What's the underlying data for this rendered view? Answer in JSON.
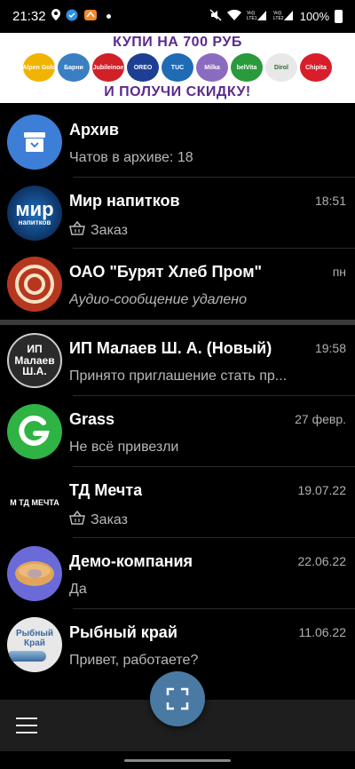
{
  "status_bar": {
    "time": "21:32",
    "battery": "100%",
    "signal1": "Vo))\nLTE1",
    "signal2": "Vo))\nLTE2"
  },
  "ad": {
    "line1": "КУПИ НА 700 РУБ",
    "line2": "И ПОЛУЧИ СКИДКУ!",
    "logos": [
      {
        "label": "Alpen Gold",
        "color": "#f0b400"
      },
      {
        "label": "Барни",
        "color": "#3a7fc1"
      },
      {
        "label": "Jubileinoe",
        "color": "#d02028"
      },
      {
        "label": "OREO",
        "color": "#1c3f94"
      },
      {
        "label": "TUC",
        "color": "#1f6bb4"
      },
      {
        "label": "Milka",
        "color": "#8b6bbf"
      },
      {
        "label": "belVita",
        "color": "#2a9a3c"
      },
      {
        "label": "Dirol",
        "color": "#e8e8e8"
      },
      {
        "label": "Chipita",
        "color": "#d81e2a"
      }
    ]
  },
  "chats": [
    {
      "name": "Архив",
      "time": "",
      "preview": "Чатов в архиве: 18",
      "preview_style": "normal",
      "basket": false,
      "avatar": "archive"
    },
    {
      "name": "Мир напитков",
      "time": "18:51",
      "preview": "Заказ",
      "preview_style": "normal",
      "basket": true,
      "avatar": "mir"
    },
    {
      "name": "ОАО \"Бурят Хлеб Пром\"",
      "time": "пн",
      "preview": "Аудио-сообщение удалено",
      "preview_style": "italic",
      "basket": false,
      "avatar": "buryat"
    },
    {
      "name": "ИП Малаев Ш. А. (Новый)",
      "time": "19:58",
      "preview": "Принято приглашение стать пр...",
      "preview_style": "normal",
      "basket": false,
      "avatar": "malaev"
    },
    {
      "name": "Grass",
      "time": "27 февр.",
      "preview": "Не всё привезли",
      "preview_style": "normal",
      "basket": false,
      "avatar": "grass"
    },
    {
      "name": "ТД Мечта",
      "time": "19.07.22",
      "preview": "Заказ",
      "preview_style": "normal",
      "basket": true,
      "avatar": "mechta"
    },
    {
      "name": "Демо-компания",
      "time": "22.06.22",
      "preview": "Да",
      "preview_style": "normal",
      "basket": false,
      "avatar": "demo"
    },
    {
      "name": "Рыбный край",
      "time": "11.06.22",
      "preview": "Привет, работаете?",
      "preview_style": "normal",
      "basket": false,
      "avatar": "ryba"
    }
  ],
  "avatars": {
    "mir_text": "мир\nнапитков",
    "malaev_text": "ИП\nМалаев\nШ.А.",
    "mechta_text": "ТД МЕЧТА",
    "ryba_text": "Рыбный Край"
  },
  "colors": {
    "accent": "#4a7aa4",
    "archive": "#3d7fd6",
    "grass": "#2fb344"
  }
}
